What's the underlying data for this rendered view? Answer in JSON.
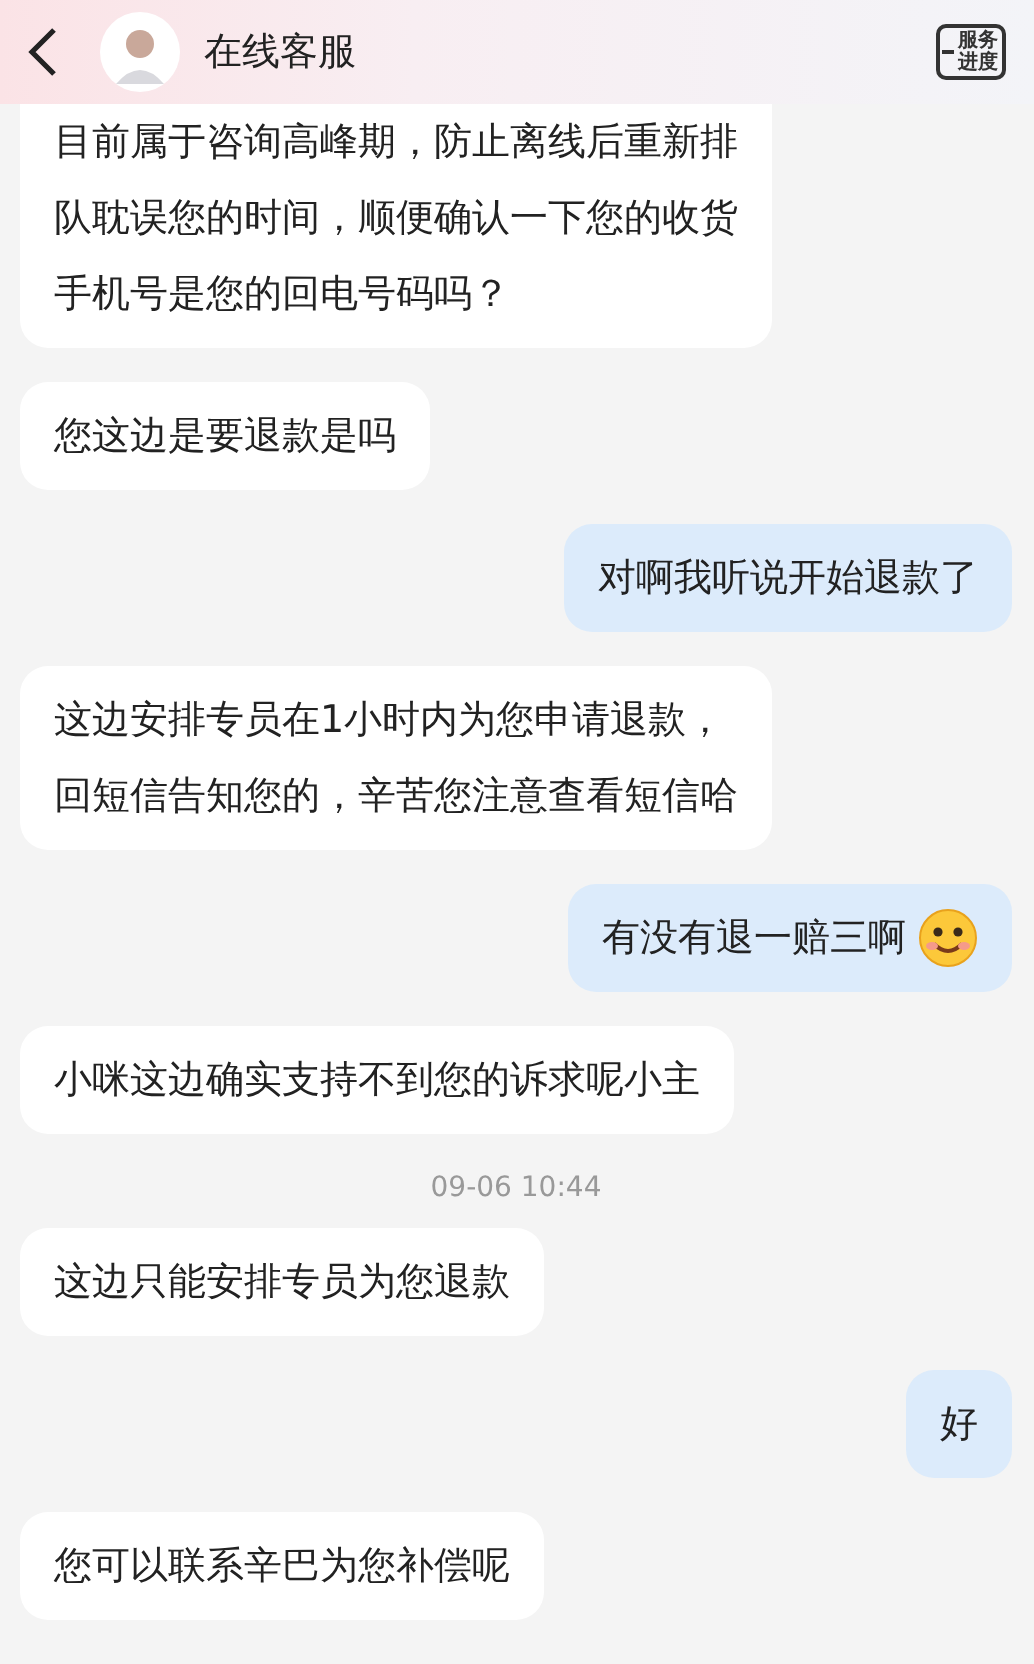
{
  "header": {
    "title": "在线客服",
    "progress_label": [
      "服务",
      "进度"
    ]
  },
  "messages": [
    {
      "kind": "incoming",
      "lines": [
        "目前属于咨询高峰期，防止离线后重新排",
        "队耽误您的时间，顺便确认一下您的收货",
        "手机号是您的回电号码吗？"
      ],
      "cut_top": true
    },
    {
      "kind": "incoming",
      "lines": [
        "您这边是要退款是吗"
      ]
    },
    {
      "kind": "outgoing",
      "lines": [
        "对啊我听说开始退款了"
      ]
    },
    {
      "kind": "incoming",
      "lines": [
        "这边安排专员在1小时内为您申请退款，",
        "回短信告知您的，辛苦您注意查看短信哈"
      ]
    },
    {
      "kind": "outgoing",
      "lines": [
        "有没有退一赔三啊"
      ],
      "emoji": true
    },
    {
      "kind": "incoming",
      "lines": [
        "小咪这边确实支持不到您的诉求呢小主"
      ]
    },
    {
      "kind": "time",
      "text": "09-06 10:44"
    },
    {
      "kind": "incoming",
      "lines": [
        "这边只能安排专员为您退款"
      ]
    },
    {
      "kind": "outgoing",
      "lines": [
        "好"
      ]
    },
    {
      "kind": "incoming",
      "lines": [
        "您可以联系辛巴为您补偿呢"
      ]
    }
  ]
}
